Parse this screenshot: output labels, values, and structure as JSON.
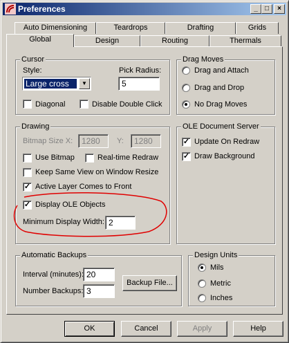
{
  "window": {
    "title": "Preferences",
    "min": "_",
    "max": "□",
    "close": "×"
  },
  "tabs_back": [
    "Auto Dimensioning",
    "Teardrops",
    "Drafting",
    "Grids"
  ],
  "tabs_front": [
    "Global",
    "Design",
    "Routing",
    "Thermals"
  ],
  "cursor": {
    "group": "Cursor",
    "style_label": "Style:",
    "style_value": "Large cross",
    "pick_label": "Pick Radius:",
    "pick_value": "5",
    "diagonal": "Diagonal",
    "disable_dbl": "Disable Double Click"
  },
  "drag": {
    "group": "Drag Moves",
    "attach": "Drag and Attach",
    "drop": "Drag and Drop",
    "none": "No Drag Moves"
  },
  "drawing": {
    "group": "Drawing",
    "bitmap_label": "Bitmap Size X:",
    "bitmap_x": "1280",
    "y_label": "Y:",
    "bitmap_y": "1280",
    "use_bitmap": "Use Bitmap",
    "realtime": "Real-time Redraw",
    "keep_view": "Keep Same View on Window Resize",
    "active_layer": "Active Layer Comes to Front",
    "display_ole": "Display OLE Objects",
    "min_width_label": "Minimum Display Width:",
    "min_width_value": "2"
  },
  "ole": {
    "group": "OLE Document Server",
    "update": "Update On Redraw",
    "draw_bg": "Draw Background"
  },
  "backups": {
    "group": "Automatic Backups",
    "interval_label": "Interval (minutes):",
    "interval_value": "20",
    "number_label": "Number Backups:",
    "number_value": "3",
    "file_button": "Backup File..."
  },
  "units": {
    "group": "Design Units",
    "mils": "Mils",
    "metric": "Metric",
    "inches": "Inches"
  },
  "buttons": {
    "ok": "OK",
    "cancel": "Cancel",
    "apply": "Apply",
    "help": "Help"
  },
  "colors": {
    "title_start": "#0a246a",
    "title_end": "#a6caf0",
    "annotation": "#e00000"
  }
}
